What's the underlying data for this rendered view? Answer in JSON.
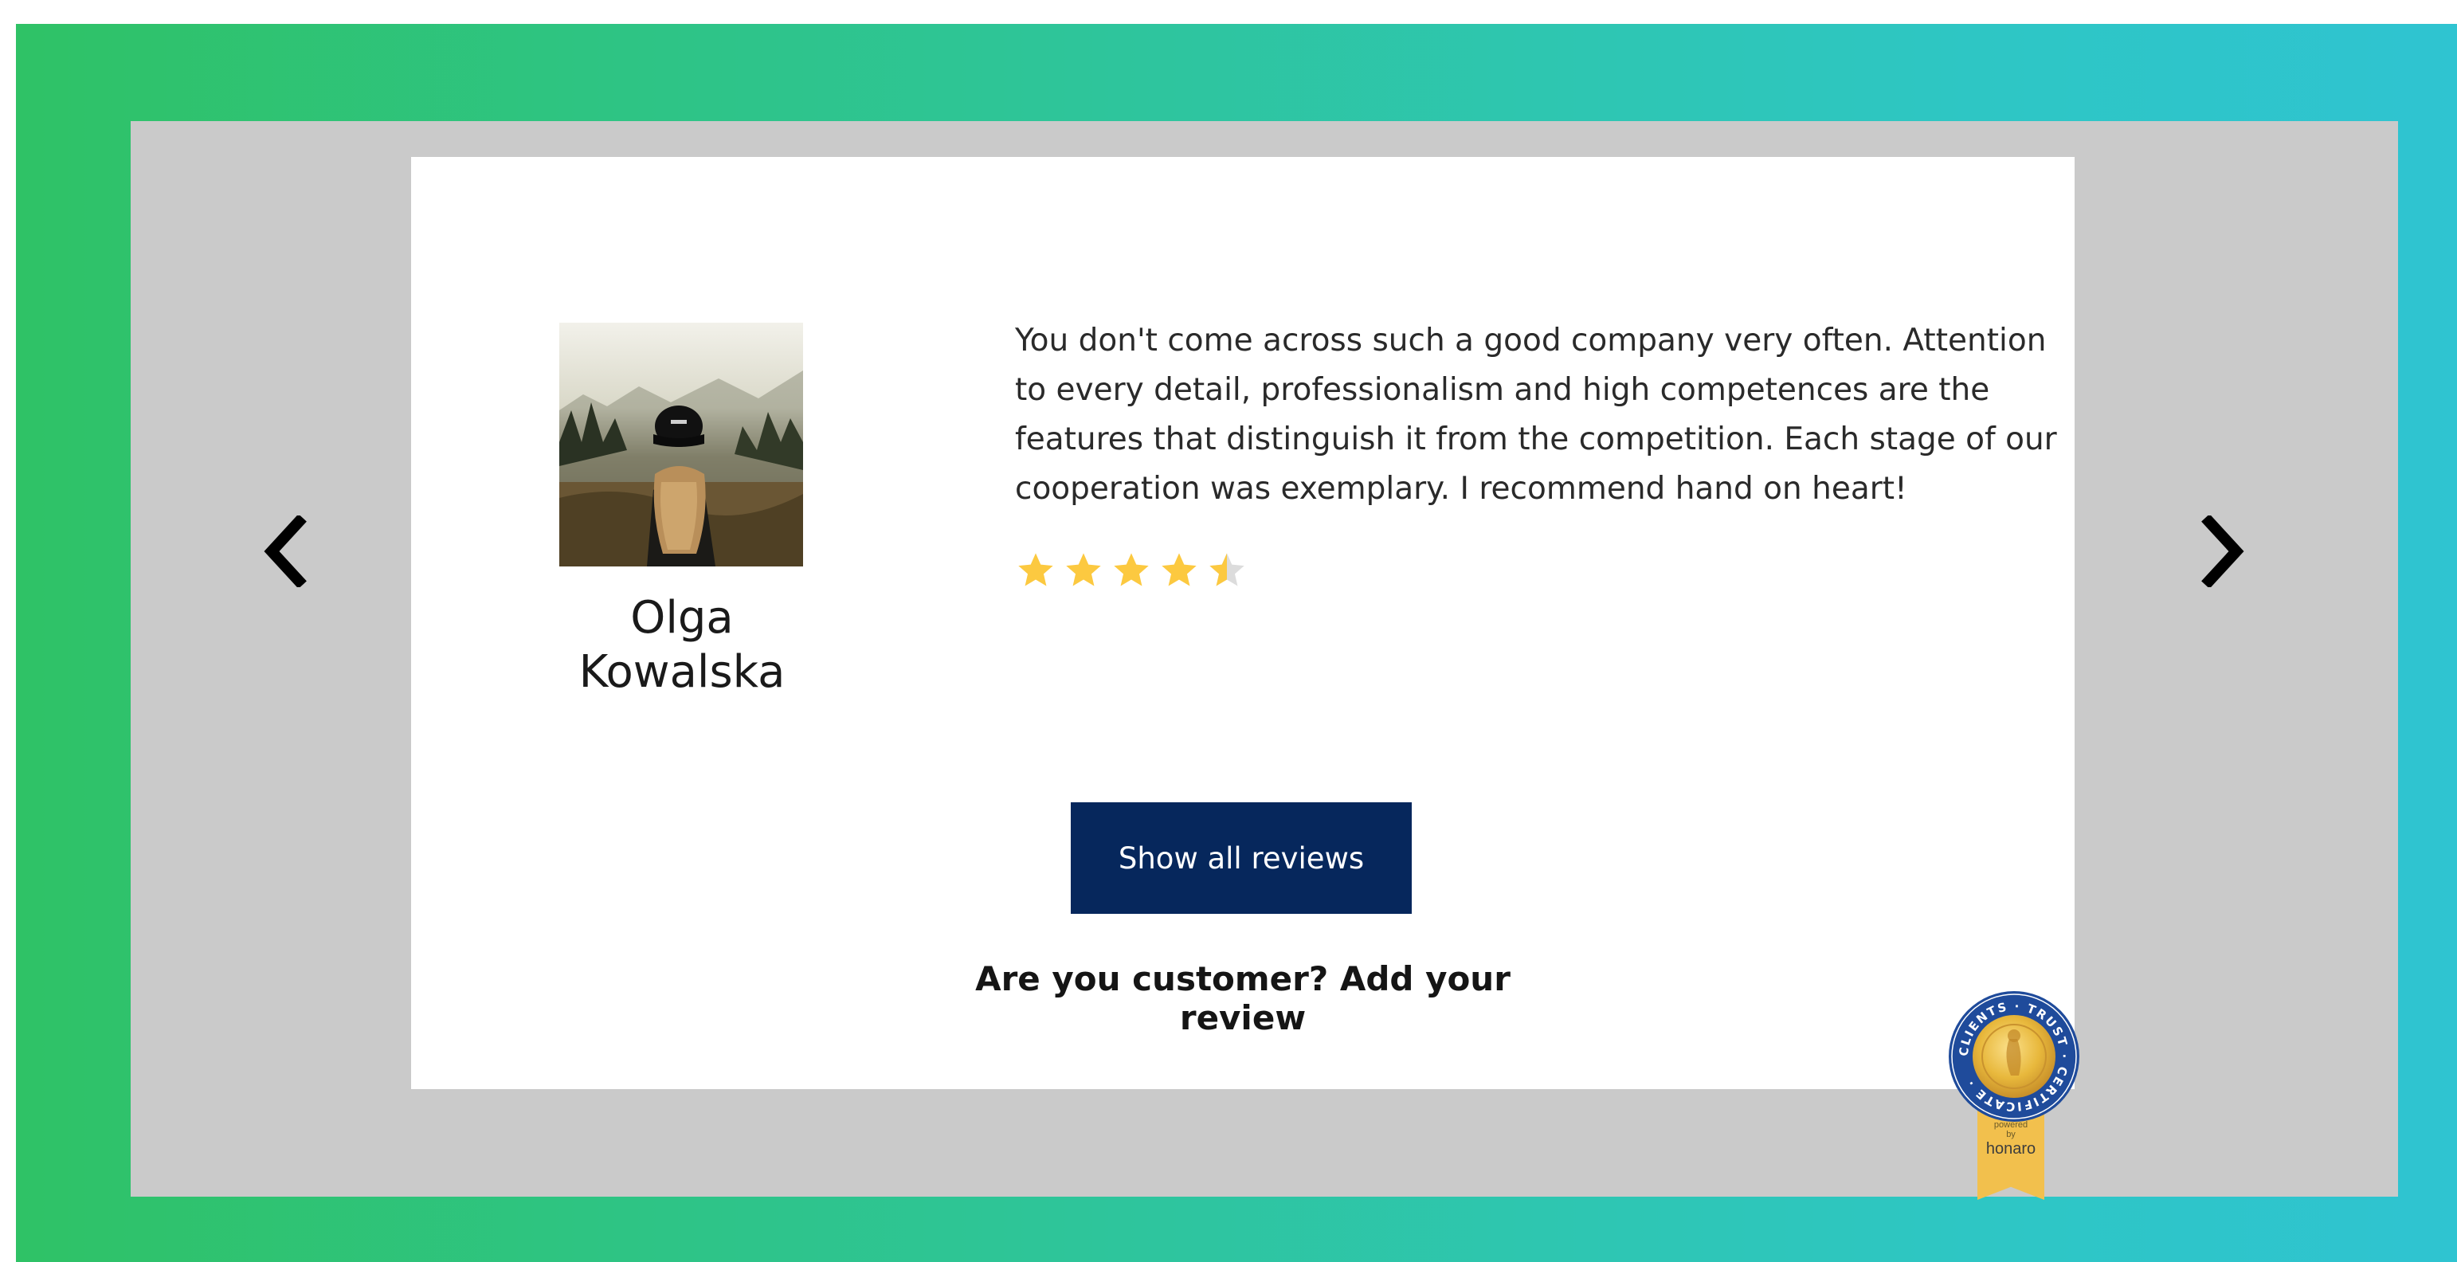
{
  "review": {
    "reviewer_name": "Olga Kowalska",
    "text": "You don't come across such a good company very often. Attention to every detail, professionalism and high competences are the features that distinguish it from the competition. Each stage of our cooperation was exemplary. I recommend hand on heart!",
    "rating": 4.5,
    "rating_max": 5
  },
  "actions": {
    "show_all_label": "Show all reviews",
    "add_review_label": "Are you customer? Add your review"
  },
  "nav": {
    "prev_icon": "chevron-left-icon",
    "next_icon": "chevron-right-icon"
  },
  "badge": {
    "seal_text": "CLIENTS · TRUST · CERTIFICATE ·",
    "powered": "powered",
    "by": "by",
    "brand": "honaro"
  },
  "colors": {
    "background_gradient": [
      "#2fc266",
      "#2fc4d1"
    ],
    "panel": "#cacaca",
    "button": "#06275c",
    "star": "#fcc940",
    "star_empty": "#dcdcdc"
  }
}
